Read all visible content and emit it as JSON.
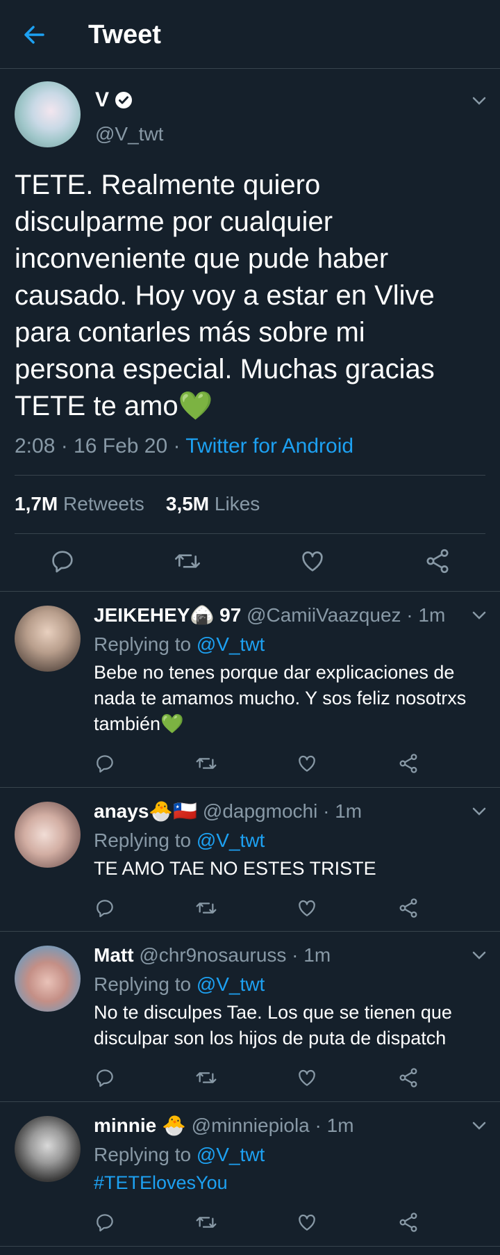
{
  "header": {
    "title": "Tweet",
    "back_icon": "arrow-left-icon",
    "accent": "#1da1f2"
  },
  "tweet": {
    "name": "V",
    "handle": "@V_twt",
    "text": "TETE. Realmente quiero disculparme por cualquier inconveniente que pude haber causado. Hoy voy a estar en Vlive para contarles más sobre mi persona especial. Muchas gracias TETE te amo💚",
    "time": "2:08 · 16 Feb 20 · ",
    "source": "Twitter for Android",
    "retweets_count": "1,7M",
    "retweets_label": " Retweets",
    "likes_count": "3,5M",
    "likes_label": " Likes"
  },
  "replies": [
    {
      "name": "JEIKEHEY🍙 97",
      "meta": "@CamiiVaazquez · 1m",
      "replying_label": "Replying to ",
      "replying_to": "@V_twt",
      "text": "Bebe no tenes porque dar explicaciones de nada te amamos mucho. Y sos feliz nosotrxs también💚"
    },
    {
      "name": "anays🐣🇨🇱",
      "meta": "@dapgmochi · 1m",
      "replying_label": "Replying to ",
      "replying_to": "@V_twt",
      "text": "TE AMO TAE NO ESTES TRISTE"
    },
    {
      "name": "Matt",
      "meta": "@chr9nosauruss · 1m",
      "replying_label": "Replying to ",
      "replying_to": "@V_twt",
      "text": "No te disculpes Tae. Los que se tienen que disculpar son los hijos de puta de dispatch"
    },
    {
      "name": "minnie 🐣",
      "meta": "@minniepiola · 1m",
      "replying_label": "Replying to ",
      "replying_to": "@V_twt",
      "text": "#TETElovesYou"
    }
  ]
}
